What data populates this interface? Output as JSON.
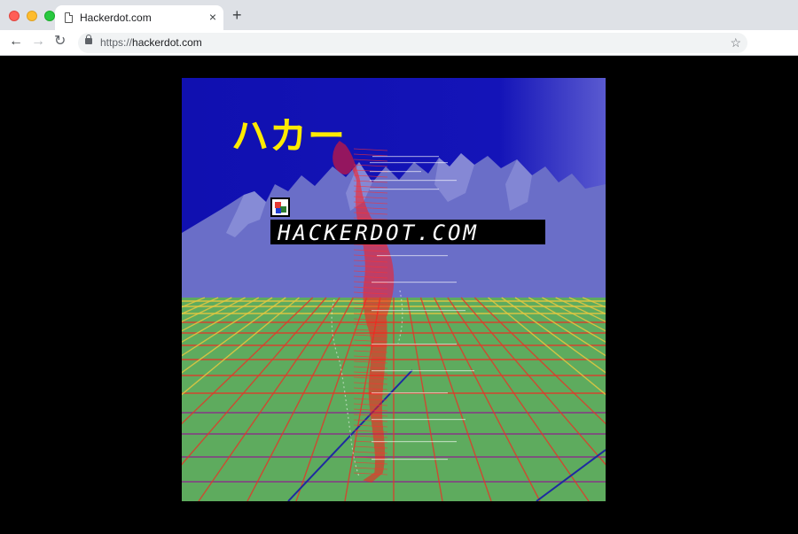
{
  "browser": {
    "tab_title": "Hackerdot.com",
    "close_glyph": "×",
    "new_tab_glyph": "+",
    "back_glyph": "←",
    "forward_glyph": "→",
    "reload_glyph": "↻",
    "url_scheme": "https://",
    "url_host": "hackerdot.com",
    "star_glyph": "☆"
  },
  "artwork": {
    "katakana_title": "ハカー",
    "banner_text": "HACKERDOT.COM",
    "colors": {
      "sky_top": "#0f0fae",
      "sky_bottom": "#1a1ab8",
      "mountains": "#6a6ec8",
      "floor": "#5eab5e",
      "katakana": "#ffea00",
      "figure": "#ff1a1a"
    }
  }
}
